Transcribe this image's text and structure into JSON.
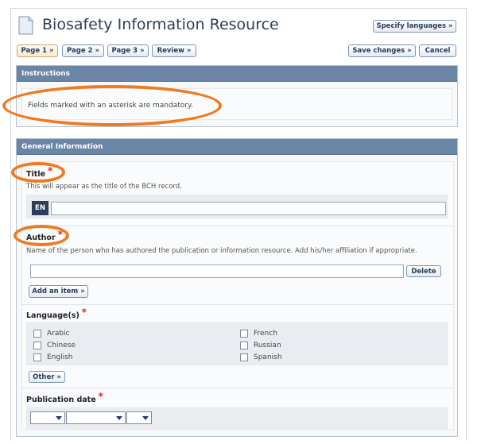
{
  "header": {
    "title": "Biosafety Information Resource",
    "icon": "document-icon",
    "specify_languages": "Specify languages »"
  },
  "nav": {
    "pages": [
      "Page 1 »",
      "Page 2 »",
      "Page 3 »",
      "Review »"
    ],
    "active_index": 0,
    "save": "Save changes »",
    "cancel": "Cancel"
  },
  "instructions": {
    "heading": "Instructions",
    "text": "Fields marked with an asterisk are mandatory."
  },
  "general": {
    "heading": "General Information",
    "title_field": {
      "label": "Title",
      "required": "*",
      "help": "This will appear as the title of the BCH record.",
      "lang": "EN",
      "value": ""
    },
    "author_field": {
      "label": "Author",
      "required": "*",
      "help": "Name of the person who has authored the publication or information resource. Add his/her affiliation if appropriate.",
      "value": "",
      "delete": "Delete",
      "add_item": "Add an item »"
    },
    "languages_field": {
      "label": "Language(s)",
      "required": "*",
      "options_left": [
        "Arabic",
        "Chinese",
        "English"
      ],
      "options_right": [
        "French",
        "Russian",
        "Spanish"
      ],
      "other": "Other »"
    },
    "pubdate_field": {
      "label": "Publication date",
      "required": "*",
      "day": "",
      "month": "",
      "year": ""
    }
  },
  "colors": {
    "accent_orange": "#f07a20",
    "header_blue": "#6b85a6",
    "required_red": "#e1251b"
  }
}
